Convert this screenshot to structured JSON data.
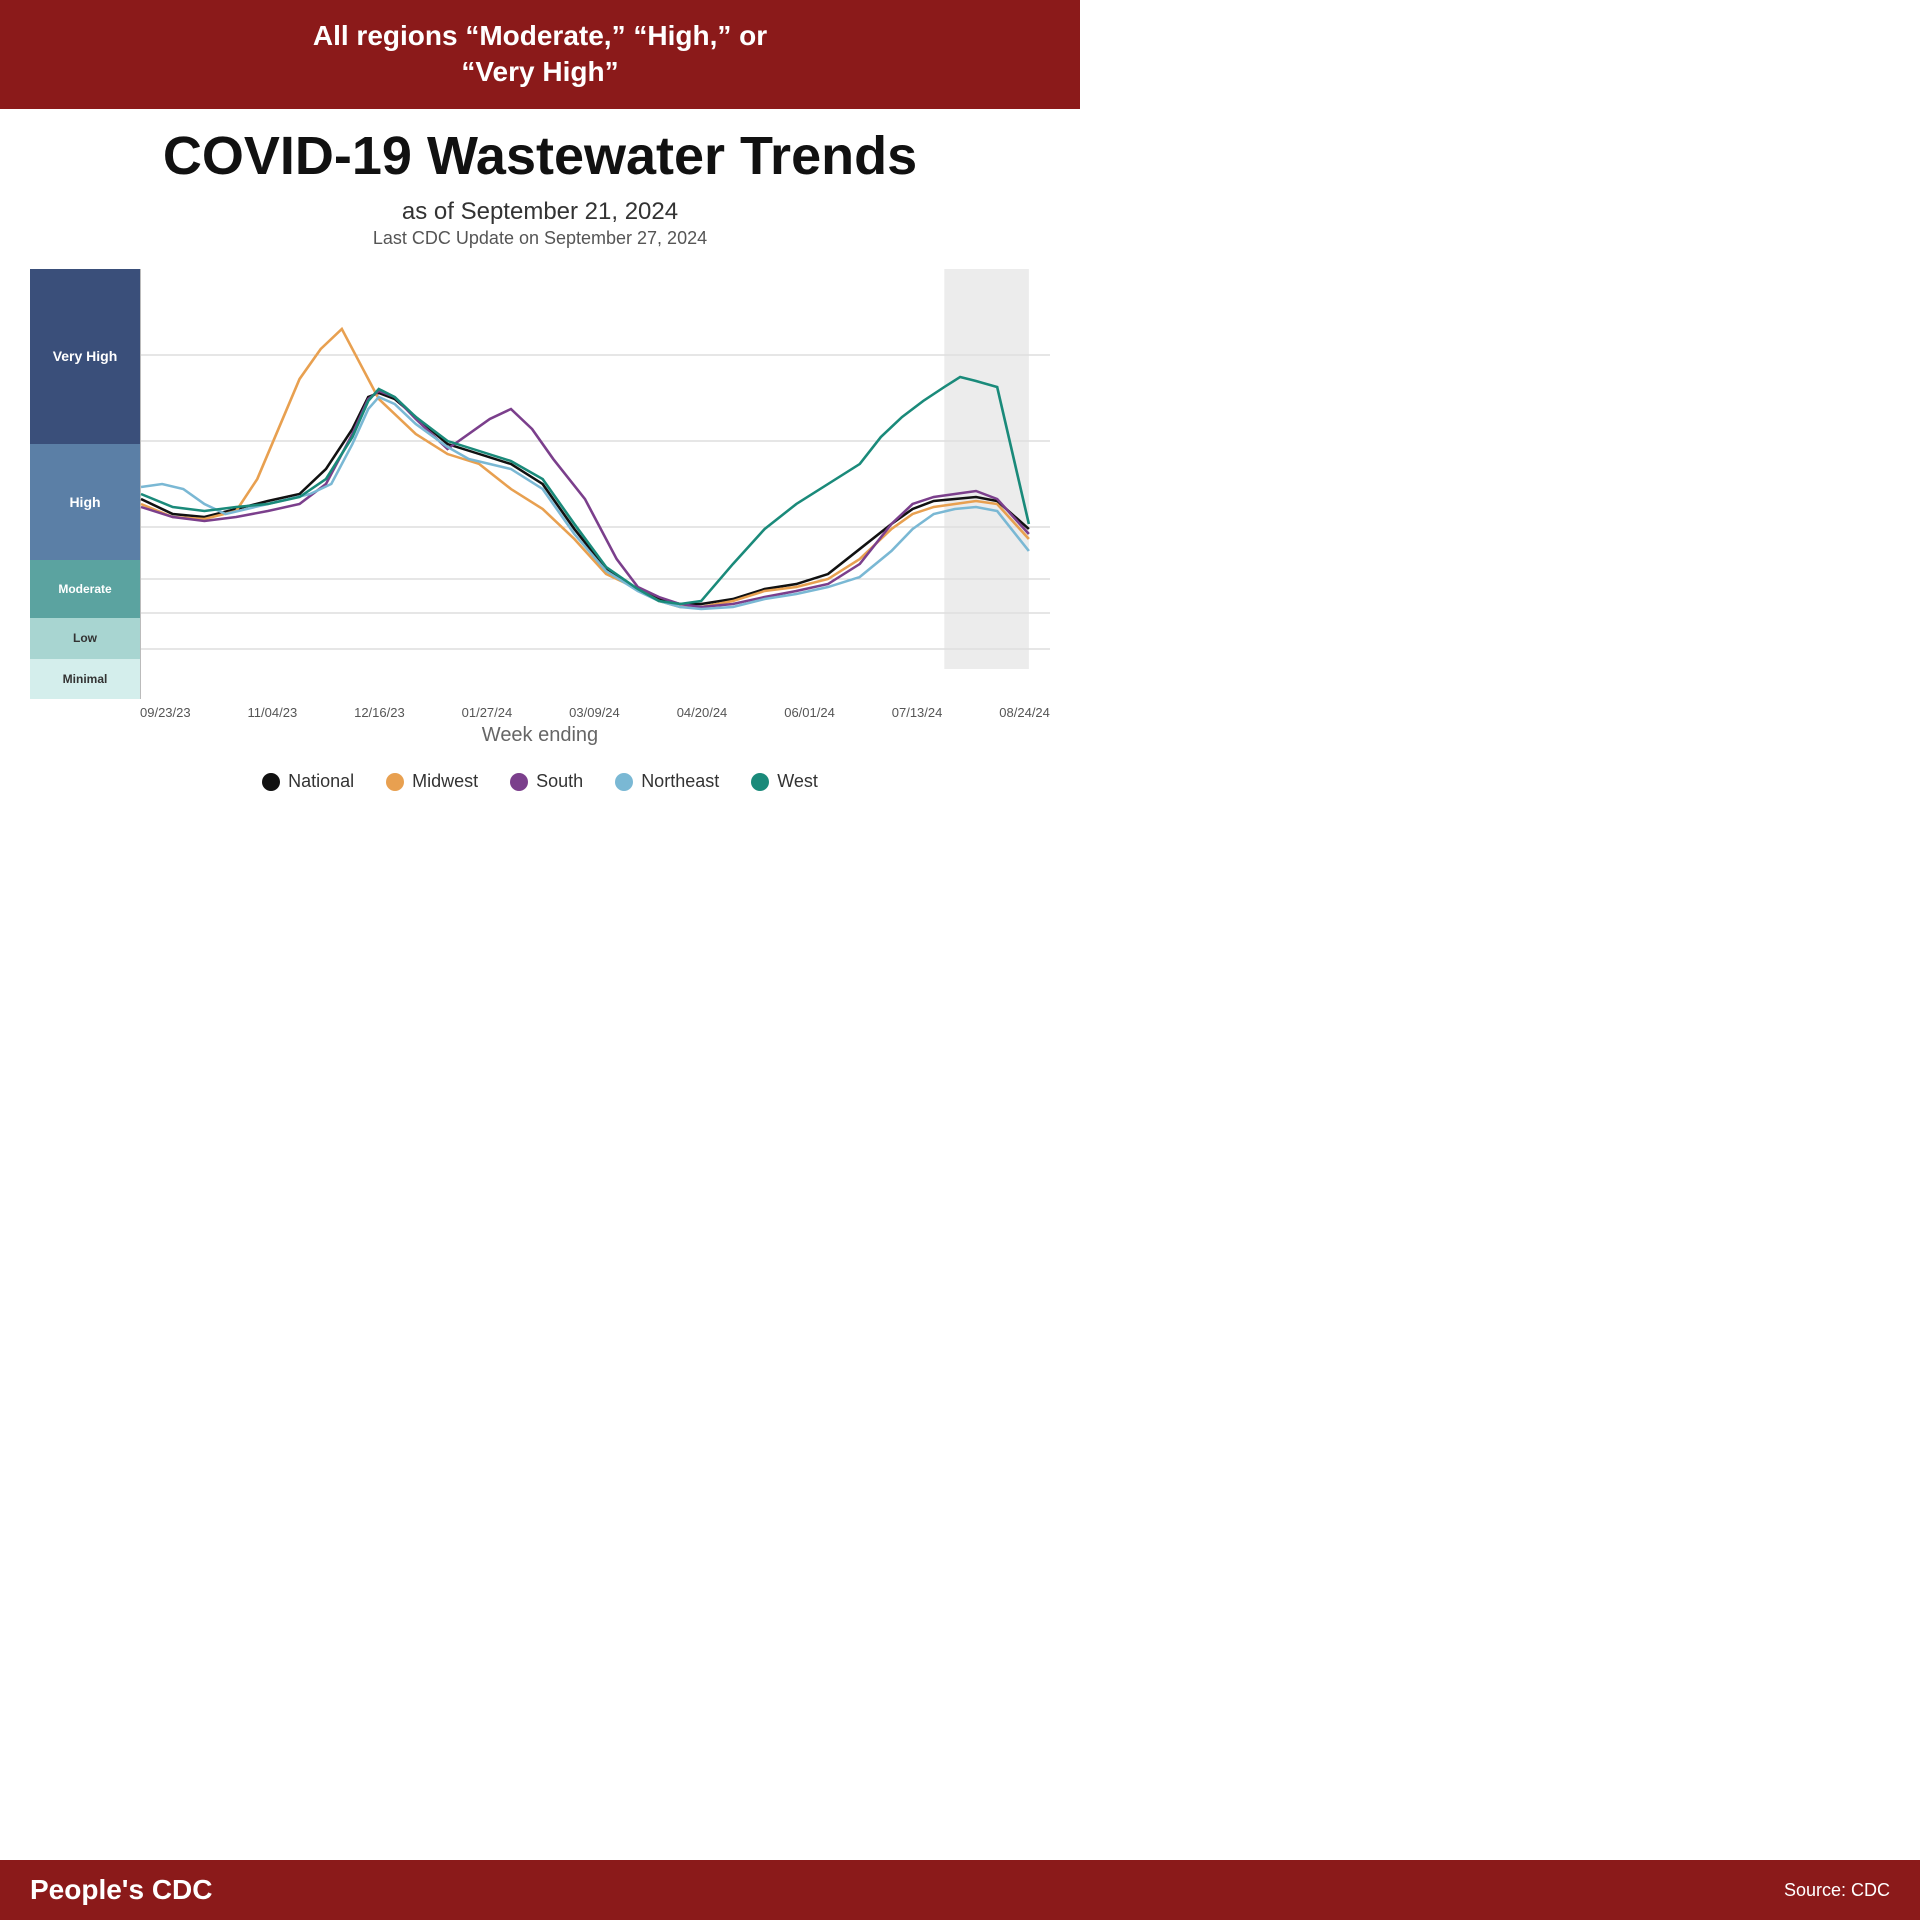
{
  "header": {
    "banner_text_line1": "All regions “Moderate,” “High,” or",
    "banner_text_line2": "“Very High”",
    "main_title": "COVID-19 Wastewater Trends",
    "subtitle": "as of September 21, 2024",
    "update_text": "Last CDC Update on September 27, 2024"
  },
  "y_axis": {
    "very_high": "Very High",
    "high": "High",
    "moderate": "Moderate",
    "low": "Low",
    "minimal": "Minimal"
  },
  "x_axis": {
    "labels": [
      "09/23/23",
      "11/04/23",
      "12/16/23",
      "01/27/24",
      "03/09/24",
      "04/20/24",
      "06/01/24",
      "07/13/24",
      "08/24/24"
    ],
    "axis_label": "Week ending"
  },
  "legend": {
    "items": [
      {
        "name": "National",
        "color": "#111111"
      },
      {
        "name": "Midwest",
        "color": "#e8a050"
      },
      {
        "name": "South",
        "color": "#7b3f8c"
      },
      {
        "name": "Northeast",
        "color": "#7ab8d4"
      },
      {
        "name": "West",
        "color": "#1a8a7a"
      }
    ]
  },
  "footer": {
    "brand": "People's CDC",
    "source": "Source: CDC"
  }
}
